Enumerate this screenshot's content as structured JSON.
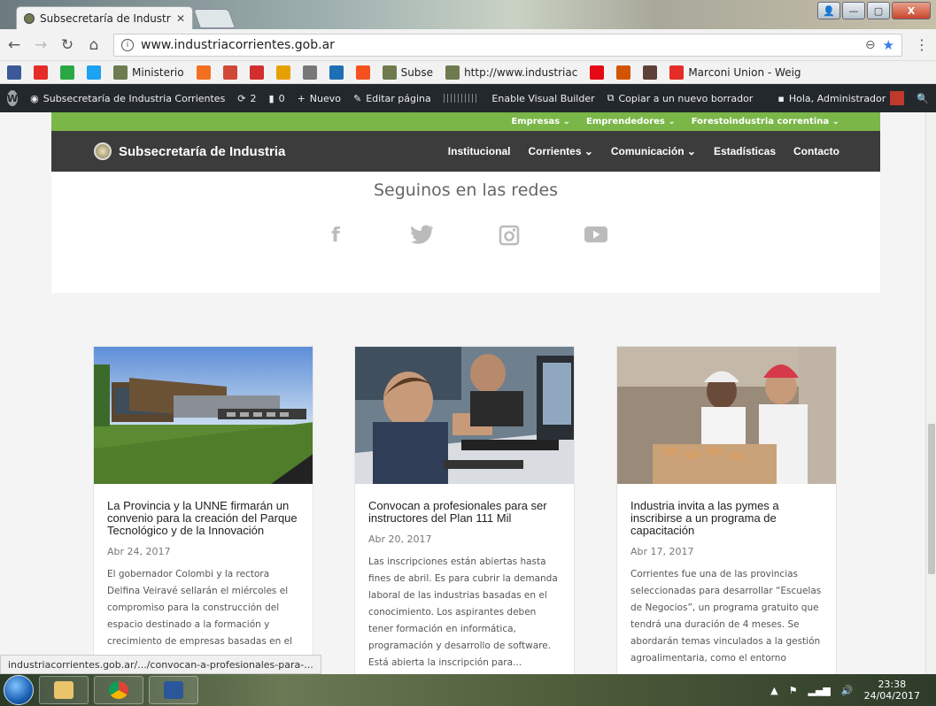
{
  "browser": {
    "tab_title": "Subsecretaría de Industri",
    "tab_close": "✕",
    "url": "www.industriacorrientes.gob.ar",
    "window_buttons": {
      "minimize": "—",
      "maximize": "▢",
      "close": "X"
    }
  },
  "bookmarks": [
    {
      "icon": "facebook-icon",
      "label": "",
      "color": "#3b5998"
    },
    {
      "icon": "youtube-icon",
      "label": "",
      "color": "#e52d27"
    },
    {
      "icon": "green-icon",
      "label": "",
      "color": "#2aa845"
    },
    {
      "icon": "twitter-icon",
      "label": "",
      "color": "#1da1f2"
    },
    {
      "icon": "seal-icon",
      "label": "Ministerio",
      "color": "#6d7b4f"
    },
    {
      "icon": "orange-icon",
      "label": "",
      "color": "#f37021"
    },
    {
      "icon": "gmail-icon",
      "label": "",
      "color": "#d14836"
    },
    {
      "icon": "red-icon",
      "label": "",
      "color": "#d32f2f"
    },
    {
      "icon": "multicolor-icon",
      "label": "",
      "color": "#e6a100"
    },
    {
      "icon": "owl-icon",
      "label": "",
      "color": "#777777"
    },
    {
      "icon": "x-icon",
      "label": "",
      "color": "#1f6fb5"
    },
    {
      "icon": "grid-icon",
      "label": "",
      "color": "#f4511e"
    },
    {
      "icon": "seal-icon",
      "label": "Subse",
      "color": "#6d7b4f"
    },
    {
      "icon": "seal-icon",
      "label": "http://www.industriac",
      "color": "#6d7b4f"
    },
    {
      "icon": "n-icon",
      "label": "",
      "color": "#e50914"
    },
    {
      "icon": "flower-icon",
      "label": "",
      "color": "#d35400"
    },
    {
      "icon": "globe-icon",
      "label": "",
      "color": "#5d4037"
    },
    {
      "icon": "youtube-icon",
      "label": "Marconi Union - Weig",
      "color": "#e52d27"
    }
  ],
  "wpbar": {
    "site": "Subsecretaría de Industria Corrientes",
    "updates": "2",
    "comments": "0",
    "new": "Nuevo",
    "edit": "Editar página",
    "visual_builder": "Enable Visual Builder",
    "copy_draft": "Copiar a un nuevo borrador",
    "greeting": "Hola, Administrador"
  },
  "topnav": [
    "Empresas ⌄",
    "Emprendedores ⌄",
    "Forestoindustria correntina ⌄"
  ],
  "mainnav": {
    "site_name": "Subsecretaría de Industria",
    "links": [
      "Institucional",
      "Corrientes ⌄",
      "Comunicación ⌄",
      "Estadísticas",
      "Contacto"
    ]
  },
  "social": {
    "heading": "Seguinos en las redes",
    "icons": [
      "f",
      "🐦",
      "◎",
      "▶"
    ]
  },
  "cards": [
    {
      "title": "La Provincia y la UNNE firmarán un convenio para la creación del Parque Tecnológico y de la Innovación",
      "date": "Abr 24, 2017",
      "excerpt": "El gobernador Colombi y la rectora Delfina Veiravé sellarán el miércoles el compromiso para la construcción del espacio destinado a la formación y crecimiento de empresas basadas en el"
    },
    {
      "title": "Convocan a profesionales para ser instructores del Plan 111 Mil",
      "date": "Abr 20, 2017",
      "excerpt": "Las inscripciones están abiertas hasta fines de abril. Es para cubrir la demanda laboral de las industrias basadas en el conocimiento. Los aspirantes deben tener formación en informática, programación y desarrollo de software. Está abierta la inscripción para..."
    },
    {
      "title": "Industria invita a las pymes a inscribirse a un programa de capacitación",
      "date": "Abr 17, 2017",
      "excerpt": "Corrientes fue una de las provincias seleccionadas para desarrollar “Escuelas de Negocios”, un programa gratuito que tendrá una duración de 4 meses. Se abordarán temas vinculados a la gestión agroalimentaria, como el entorno"
    }
  ],
  "status_url": "industriacorrientes.gob.ar/.../convocan-a-profesionales-para-...",
  "taskbar": {
    "time": "23:38",
    "date": "24/04/2017"
  },
  "colors": {
    "green_bar": "#7ab648",
    "nav_bg": "#3c3c3c",
    "wp_bar": "#23282d"
  }
}
